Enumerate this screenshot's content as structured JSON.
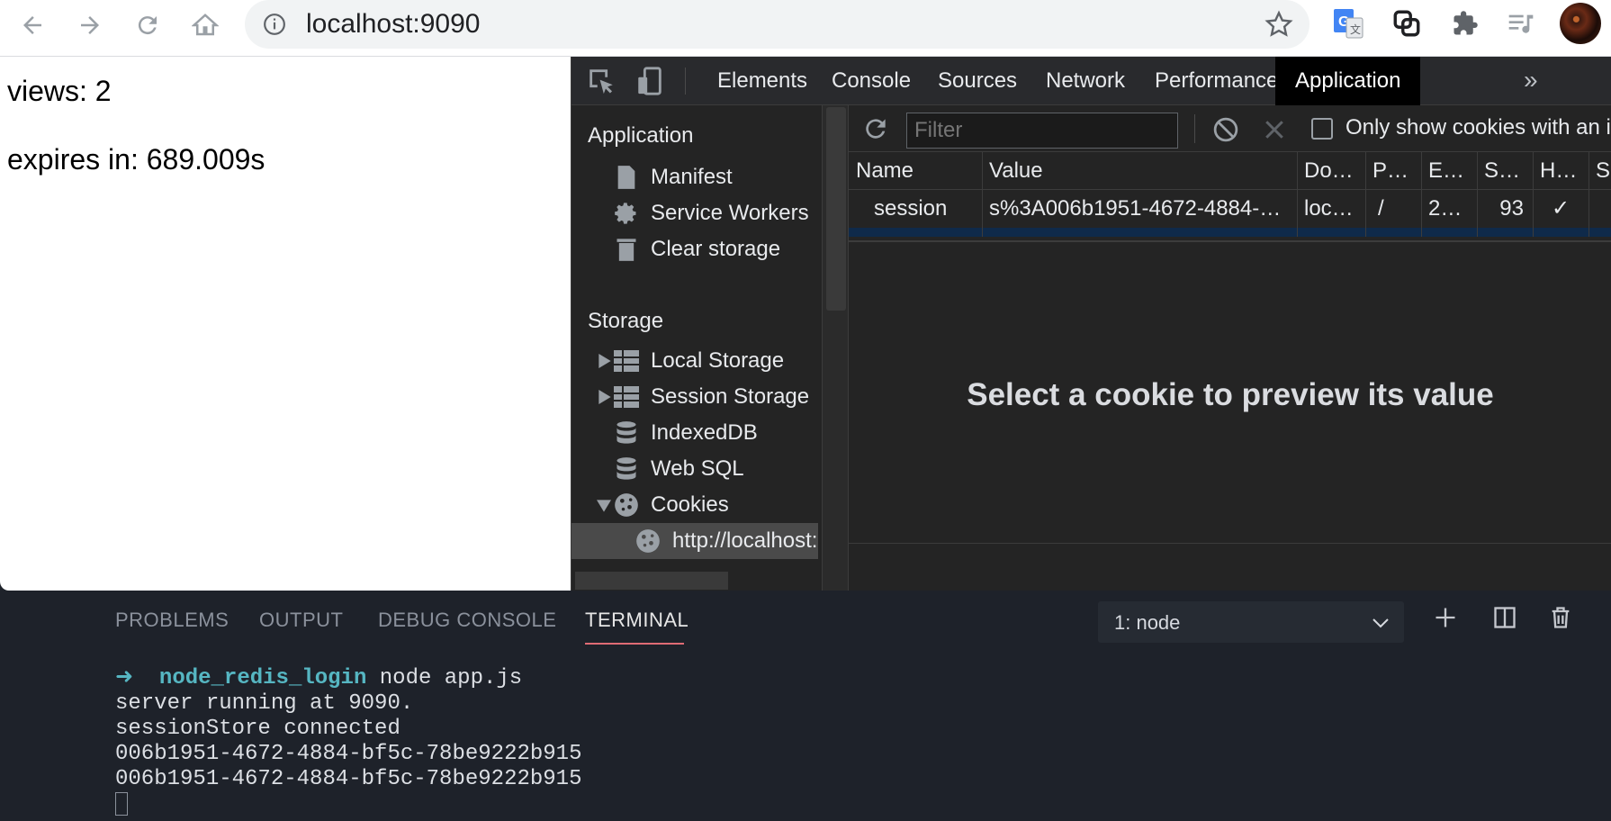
{
  "browser": {
    "url": "localhost:9090"
  },
  "page": {
    "views_text": "views: 2",
    "expires_text": "expires in: 689.009s"
  },
  "devtools": {
    "tabs": [
      "Elements",
      "Console",
      "Sources",
      "Network",
      "Performance",
      "Application"
    ],
    "active_tab": "Application",
    "sidebar": {
      "application_header": "Application",
      "application_items": [
        "Manifest",
        "Service Workers",
        "Clear storage"
      ],
      "storage_header": "Storage",
      "storage_items": [
        "Local Storage",
        "Session Storage",
        "IndexedDB",
        "Web SQL",
        "Cookies"
      ],
      "cookie_origin": "http://localhost:"
    },
    "toolbar": {
      "filter_placeholder": "Filter",
      "only_show_label": "Only show cookies with an i"
    },
    "table": {
      "headers": [
        "Name",
        "Value",
        "Do…",
        "P…",
        "E…",
        "S…",
        "H…",
        "S"
      ],
      "rows": [
        [
          "session",
          "s%3A006b1951-4672-4884-…",
          "loc…",
          "/",
          "2…",
          "93",
          "✓",
          ""
        ]
      ]
    },
    "preview_message": "Select a cookie to preview its value"
  },
  "vscode": {
    "tabs": [
      "PROBLEMS",
      "OUTPUT",
      "DEBUG CONSOLE",
      "TERMINAL"
    ],
    "active_tab": "TERMINAL",
    "terminal_select": "1: node",
    "terminal": {
      "prompt_arrow": "➜",
      "prompt_dir": "node_redis_login",
      "prompt_cmd": " node app.js",
      "lines": [
        "server running at 9090.",
        "sessionStore connected",
        "006b1951-4672-4884-bf5c-78be9222b915",
        "006b1951-4672-4884-bf5c-78be9222b915"
      ]
    }
  }
}
